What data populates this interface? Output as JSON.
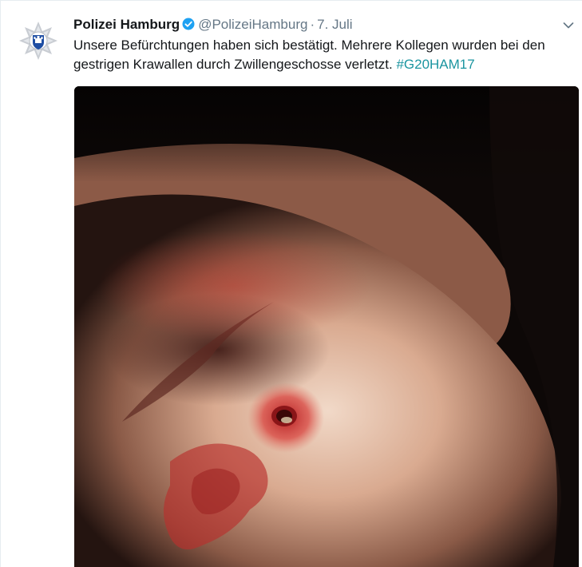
{
  "tweet": {
    "author_name": "Polizei Hamburg",
    "author_handle": "@PolizeiHamburg",
    "separator": "·",
    "date": "7. Juli",
    "text": "Unsere Befürchtungen haben sich bestätigt. Mehrere Kollegen wurden bei den gestrigen Krawallen durch Zwillengeschosse verletzt.",
    "hashtag": "#G20HAM17"
  },
  "icons": {
    "avatar": "police-star-badge-icon",
    "verified": "verified-badge-icon",
    "menu": "chevron-down-icon"
  },
  "colors": {
    "text": "#14171a",
    "secondary": "#657786",
    "hashtag": "#1b95a0",
    "verified": "#1da1f2"
  }
}
